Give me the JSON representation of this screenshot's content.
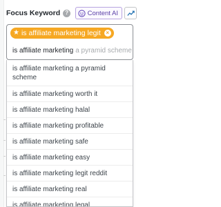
{
  "header": {
    "title": "Focus Keyword",
    "help_icon_glyph": "?",
    "content_ai_label": "Content AI",
    "trend_icon": "trend-chart-icon"
  },
  "input": {
    "tag": {
      "icon": "star-icon",
      "label": "is affiliate marketing legit",
      "remove_glyph": "×",
      "color": "#f6a823"
    },
    "typed_value": "is affiliate marketing",
    "autocomplete_hint": "a pyramid scheme"
  },
  "suggestions": [
    "is affiliate marketing a pyramid scheme",
    "is affiliate marketing worth it",
    "is affiliate marketing halal",
    "is affiliate marketing profitable",
    "is affiliate marketing safe",
    "is affiliate marketing easy",
    "is affiliate marketing legit reddit",
    "is affiliate marketing real",
    "is affiliate marketing legal"
  ],
  "colors": {
    "accent": "#f6a823",
    "content_ai": "#5a3fa6"
  }
}
